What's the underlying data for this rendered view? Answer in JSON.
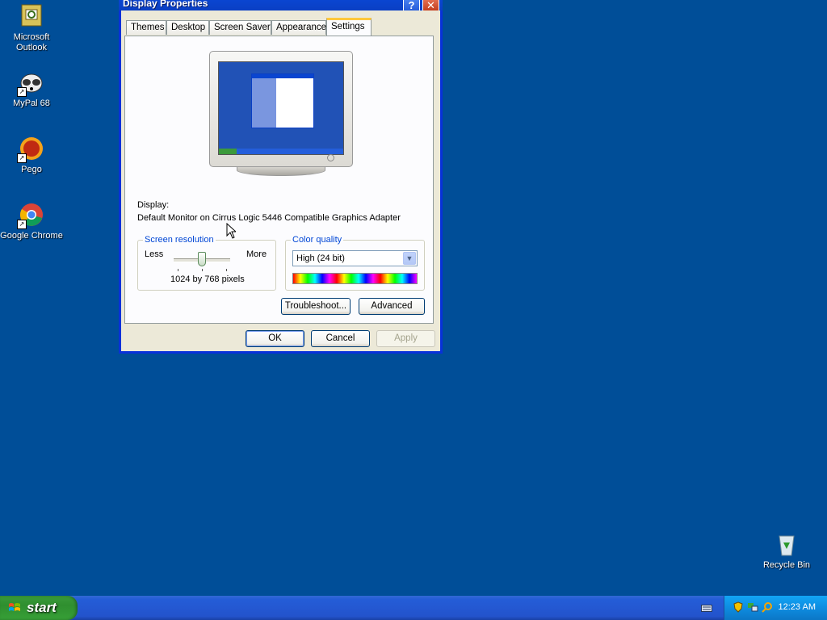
{
  "desktop": {
    "icons": [
      {
        "label": "Microsoft Outlook",
        "icon": "outlook-icon"
      },
      {
        "label": "MyPal 68",
        "icon": "mypal-icon"
      },
      {
        "label": "Pego",
        "icon": "pego-icon"
      },
      {
        "label": "Google Chrome",
        "icon": "chrome-icon"
      },
      {
        "label": "Recycle Bin",
        "icon": "recycle-bin-icon"
      }
    ]
  },
  "window": {
    "title": "Display Properties",
    "tabs": [
      "Themes",
      "Desktop",
      "Screen Saver",
      "Appearance",
      "Settings"
    ],
    "active_tab": "Settings",
    "display_label": "Display:",
    "display_value": "Default Monitor on Cirrus Logic 5446 Compatible Graphics Adapter",
    "resolution": {
      "legend": "Screen resolution",
      "less": "Less",
      "more": "More",
      "value": "1024 by 768 pixels",
      "slider_level": 0.5
    },
    "color_quality": {
      "legend": "Color quality",
      "selected": "High (24 bit)"
    },
    "buttons": {
      "troubleshoot": "Troubleshoot...",
      "advanced": "Advanced",
      "ok": "OK",
      "cancel": "Cancel",
      "apply": "Apply"
    }
  },
  "taskbar": {
    "start_label": "start",
    "clock": "12:23 AM"
  },
  "colors": {
    "desktop": "#004e98",
    "titlebar": "#0a45d0",
    "start": "#37a037",
    "tray": "#0e8ce0"
  }
}
